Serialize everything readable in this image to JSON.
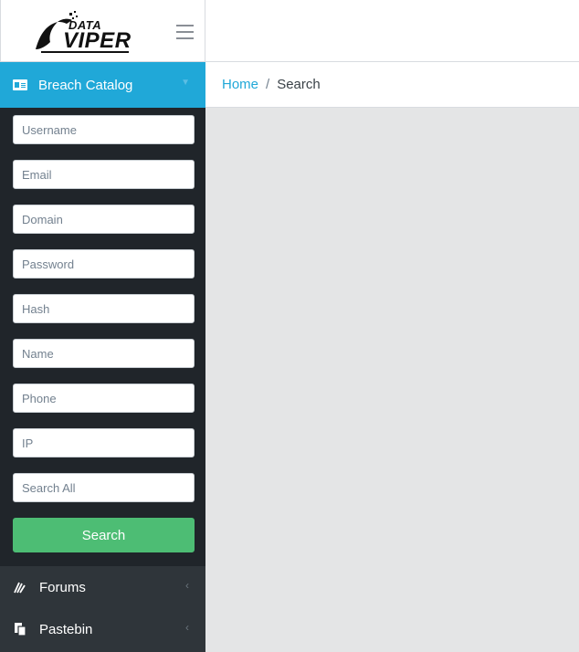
{
  "brand": {
    "logo_line1": "DATA",
    "logo_line2": "VIPER"
  },
  "sidebar": {
    "active": {
      "label": "Breach Catalog",
      "icon": "id-card-icon"
    },
    "fields": [
      {
        "placeholder": "Username"
      },
      {
        "placeholder": "Email"
      },
      {
        "placeholder": "Domain"
      },
      {
        "placeholder": "Password"
      },
      {
        "placeholder": "Hash"
      },
      {
        "placeholder": "Name"
      },
      {
        "placeholder": "Phone"
      },
      {
        "placeholder": "IP"
      },
      {
        "placeholder": "Search All"
      }
    ],
    "search_label": "Search",
    "items": [
      {
        "label": "Forums",
        "icon": "forums-icon"
      },
      {
        "label": "Pastebin",
        "icon": "pastebin-icon"
      }
    ]
  },
  "breadcrumb": {
    "home": "Home",
    "separator": "/",
    "current": "Search"
  },
  "colors": {
    "accent": "#20a8d8",
    "success": "#4dbd74",
    "sidebar": "#2f353a",
    "content_bg": "#e4e5e6"
  }
}
